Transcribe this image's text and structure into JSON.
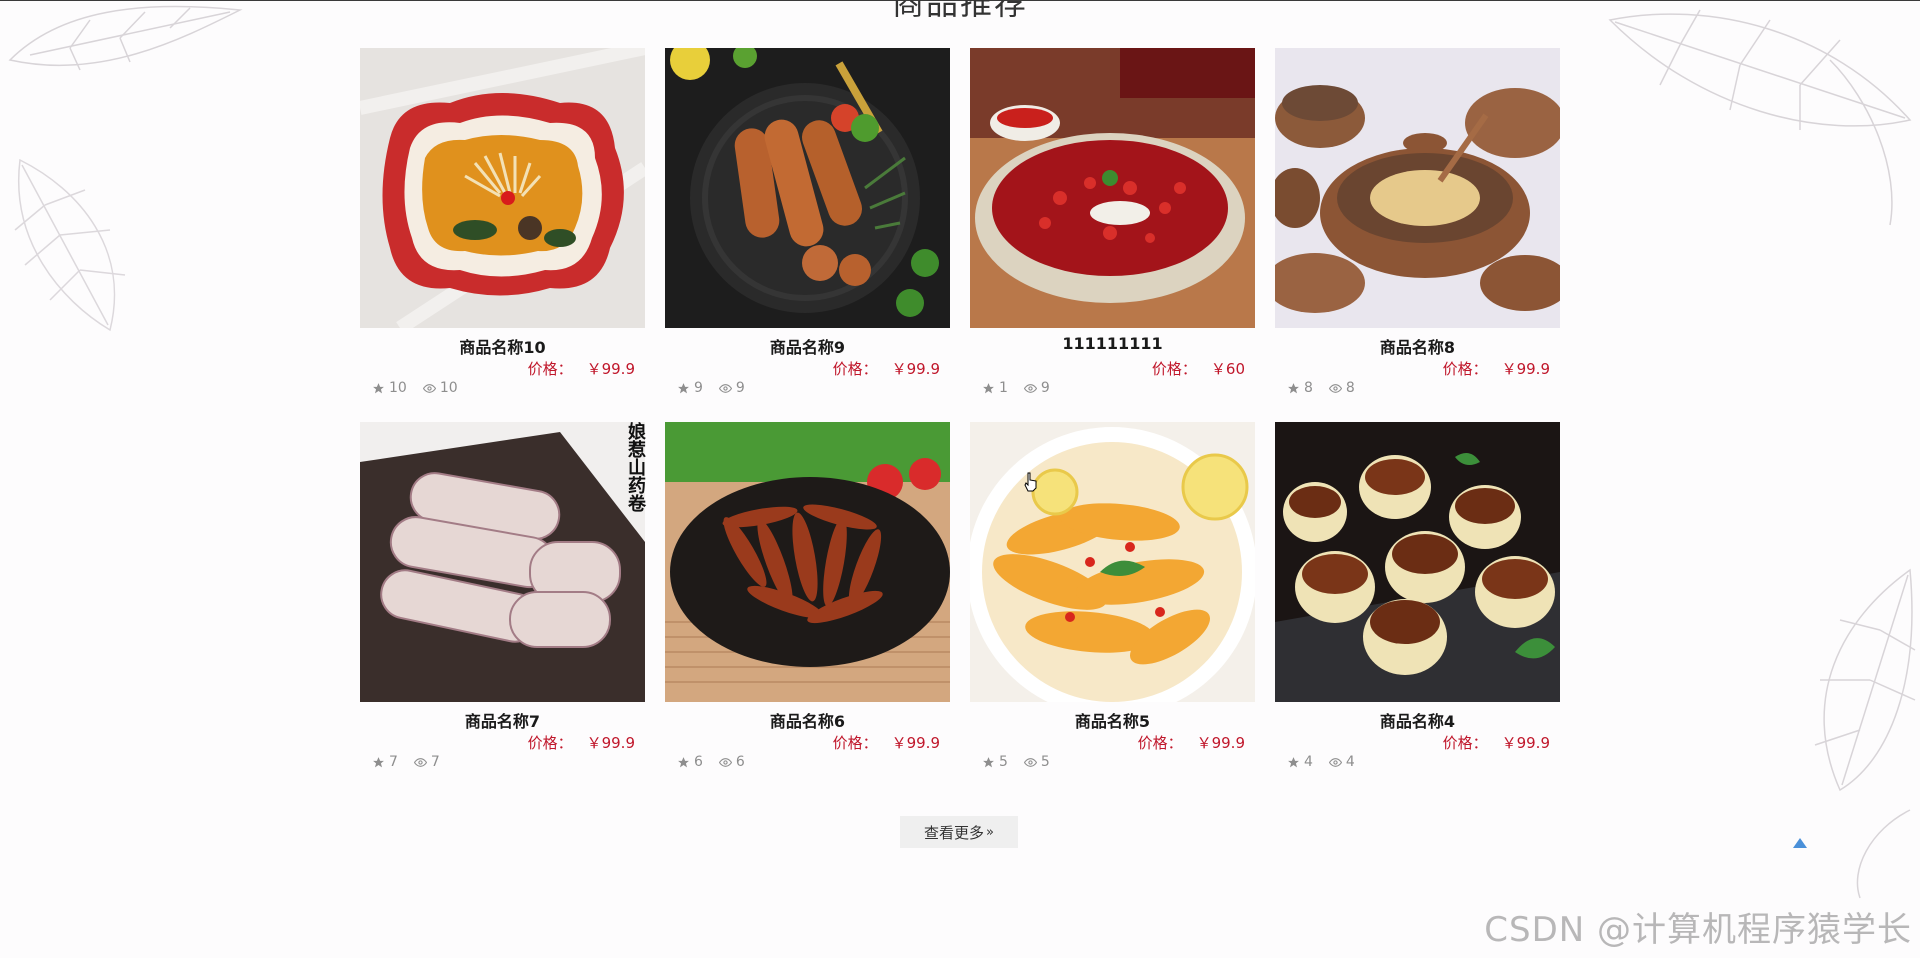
{
  "section": {
    "title": "商品推荐"
  },
  "products": [
    {
      "name": "商品名称10",
      "price_label": "价格：",
      "price": "￥99.9",
      "likes": "10",
      "views": "10",
      "image": "hotpot-enoki-icon"
    },
    {
      "name": "商品名称9",
      "price_label": "价格：",
      "price": "￥99.9",
      "likes": "9",
      "views": "9",
      "image": "sausage-plate-icon"
    },
    {
      "name": "111111111",
      "price_label": "价格：",
      "price": "￥60",
      "likes": "1",
      "views": "9",
      "image": "spicy-fish-pot-icon"
    },
    {
      "name": "商品名称8",
      "price_label": "价格：",
      "price": "￥99.9",
      "likes": "8",
      "views": "8",
      "image": "clay-pot-chicken-icon"
    },
    {
      "name": "商品名称7",
      "price_label": "价格：",
      "price": "￥99.9",
      "likes": "7",
      "views": "7",
      "image": "yam-rolls-icon",
      "image_text": "娘惹山药卷"
    },
    {
      "name": "商品名称6",
      "price_label": "价格：",
      "price": "￥99.9",
      "likes": "6",
      "views": "6",
      "image": "spicy-fish-strips-icon"
    },
    {
      "name": "商品名称5",
      "price_label": "价格：",
      "price": "￥99.9",
      "likes": "5",
      "views": "5",
      "image": "lemon-chicken-feet-icon"
    },
    {
      "name": "商品名称4",
      "price_label": "价格：",
      "price": "￥99.9",
      "likes": "4",
      "views": "4",
      "image": "tart-cups-icon"
    }
  ],
  "more_button": {
    "label": "查看更多",
    "icon": "double-chevron-right-icon"
  },
  "back_to_top": {
    "icon": "triangle-up-icon",
    "color": "#4a90d9"
  },
  "watermark": "CSDN @计算机程序猿学长",
  "colors": {
    "price": "#c0172b",
    "meta": "#8e8e8e",
    "button_bg": "#efefef"
  }
}
